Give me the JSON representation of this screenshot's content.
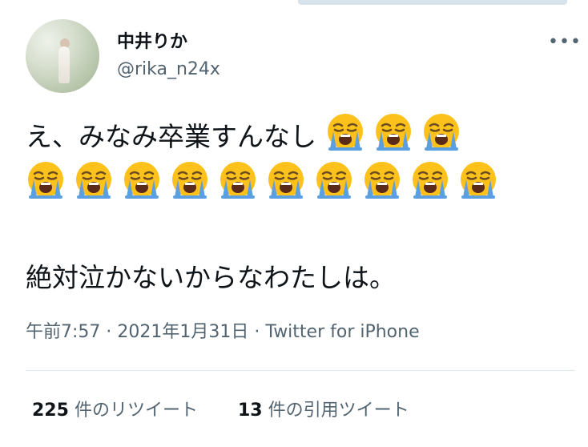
{
  "user": {
    "name": "中井りか",
    "handle": "@rika_n24x",
    "avatar_icon": "profile-photo"
  },
  "more_label": "•••",
  "tweet": {
    "line1_text": "え、みなみ卒業すんなし",
    "line3_text": "絶対泣かないからなわたしは。",
    "emoji_name": "loudly-crying-face",
    "emoji_count_line1": 3,
    "emoji_count_line2": 10
  },
  "meta": {
    "time": "午前7:57",
    "date": "2021年1月31日",
    "source": "Twitter for iPhone",
    "separator": "·"
  },
  "stats": {
    "retweets_count": "225",
    "retweets_label": "件のリツイート",
    "quotes_count": "13",
    "quotes_label": "件の引用ツイート"
  },
  "colors": {
    "text": "#0f1419",
    "secondary": "#536471",
    "divider": "#e1e8ed",
    "emoji_face": "#fcc21b",
    "emoji_tear": "#5c9fe0"
  }
}
